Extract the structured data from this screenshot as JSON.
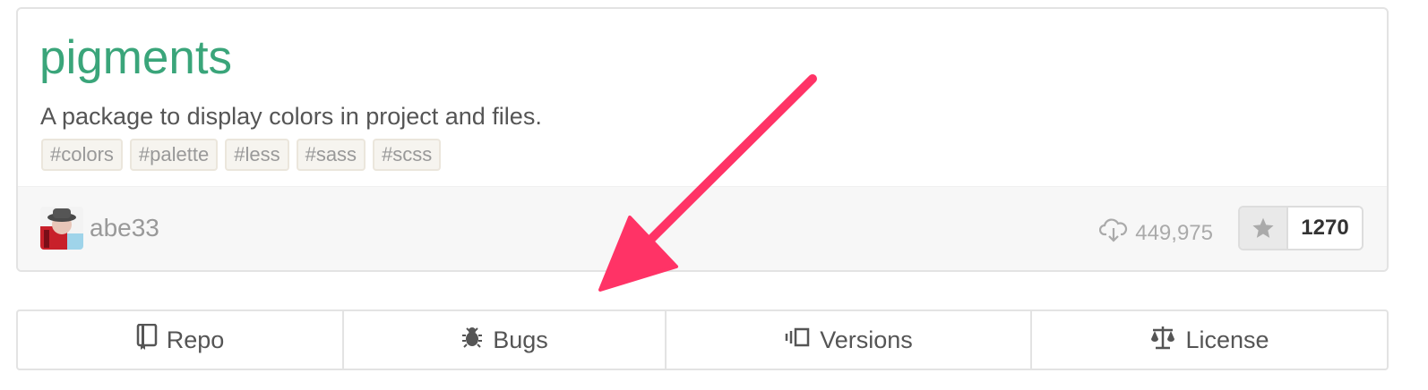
{
  "package": {
    "name": "pigments",
    "description": "A package to display colors in project and files.",
    "tags": [
      "#colors",
      "#palette",
      "#less",
      "#sass",
      "#scss"
    ]
  },
  "meta": {
    "author": "abe33",
    "downloads": "449,975",
    "stars": "1270"
  },
  "tabs": [
    {
      "label": "Repo",
      "icon": "repo-icon"
    },
    {
      "label": "Bugs",
      "icon": "bug-icon"
    },
    {
      "label": "Versions",
      "icon": "versions-icon"
    },
    {
      "label": "License",
      "icon": "law-icon"
    }
  ],
  "colors": {
    "name": "#3aa57a",
    "arrow": "#ff3366"
  }
}
